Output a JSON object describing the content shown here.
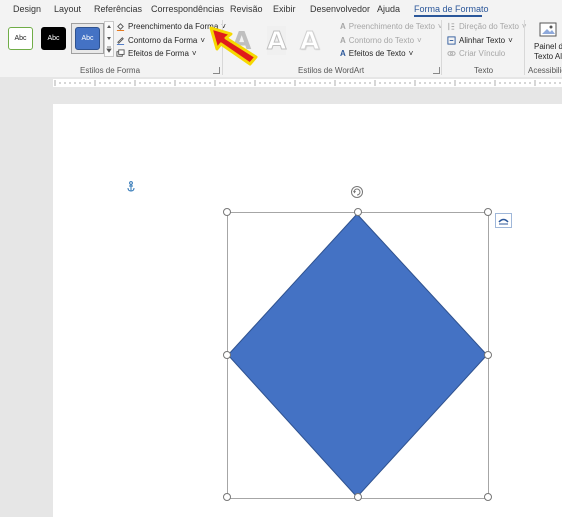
{
  "tabs": [
    {
      "label": "Design"
    },
    {
      "label": "Layout"
    },
    {
      "label": "Referências"
    },
    {
      "label": "Correspondências"
    },
    {
      "label": "Revisão"
    },
    {
      "label": "Exibir"
    },
    {
      "label": "Desenvolvedor"
    },
    {
      "label": "Ajuda"
    },
    {
      "label": "Forma de Formato"
    }
  ],
  "shape_styles": {
    "presets": [
      {
        "label": "Abc"
      },
      {
        "label": "Abc"
      },
      {
        "label": "Abc"
      }
    ],
    "fill_label": "Preenchimento da Forma",
    "outline_label": "Contorno da Forma",
    "effects_label": "Efeitos de Forma",
    "group_label": "Estilos de Forma"
  },
  "wordart": {
    "letters": [
      "A",
      "A",
      "A"
    ],
    "fill_label": "Preenchimento de Texto",
    "outline_label": "Contorno do Texto",
    "effects_label": "Efeitos de Texto",
    "group_label": "Estilos de WordArt"
  },
  "text_group": {
    "direction_label": "Direção do Texto",
    "align_label": "Alinhar Texto",
    "link_label": "Criar Vínculo",
    "group_label": "Texto"
  },
  "accessibility": {
    "pane_label_line1": "Painel de",
    "pane_label_line2": "Texto Alt",
    "group_label": "Acessibilid"
  },
  "colors": {
    "accent": "#2b579a",
    "shape_fill": "#4472c4",
    "shape_stroke": "#2f528f",
    "arrow_fill": "#e01b1b",
    "arrow_stroke": "#f5d800"
  }
}
